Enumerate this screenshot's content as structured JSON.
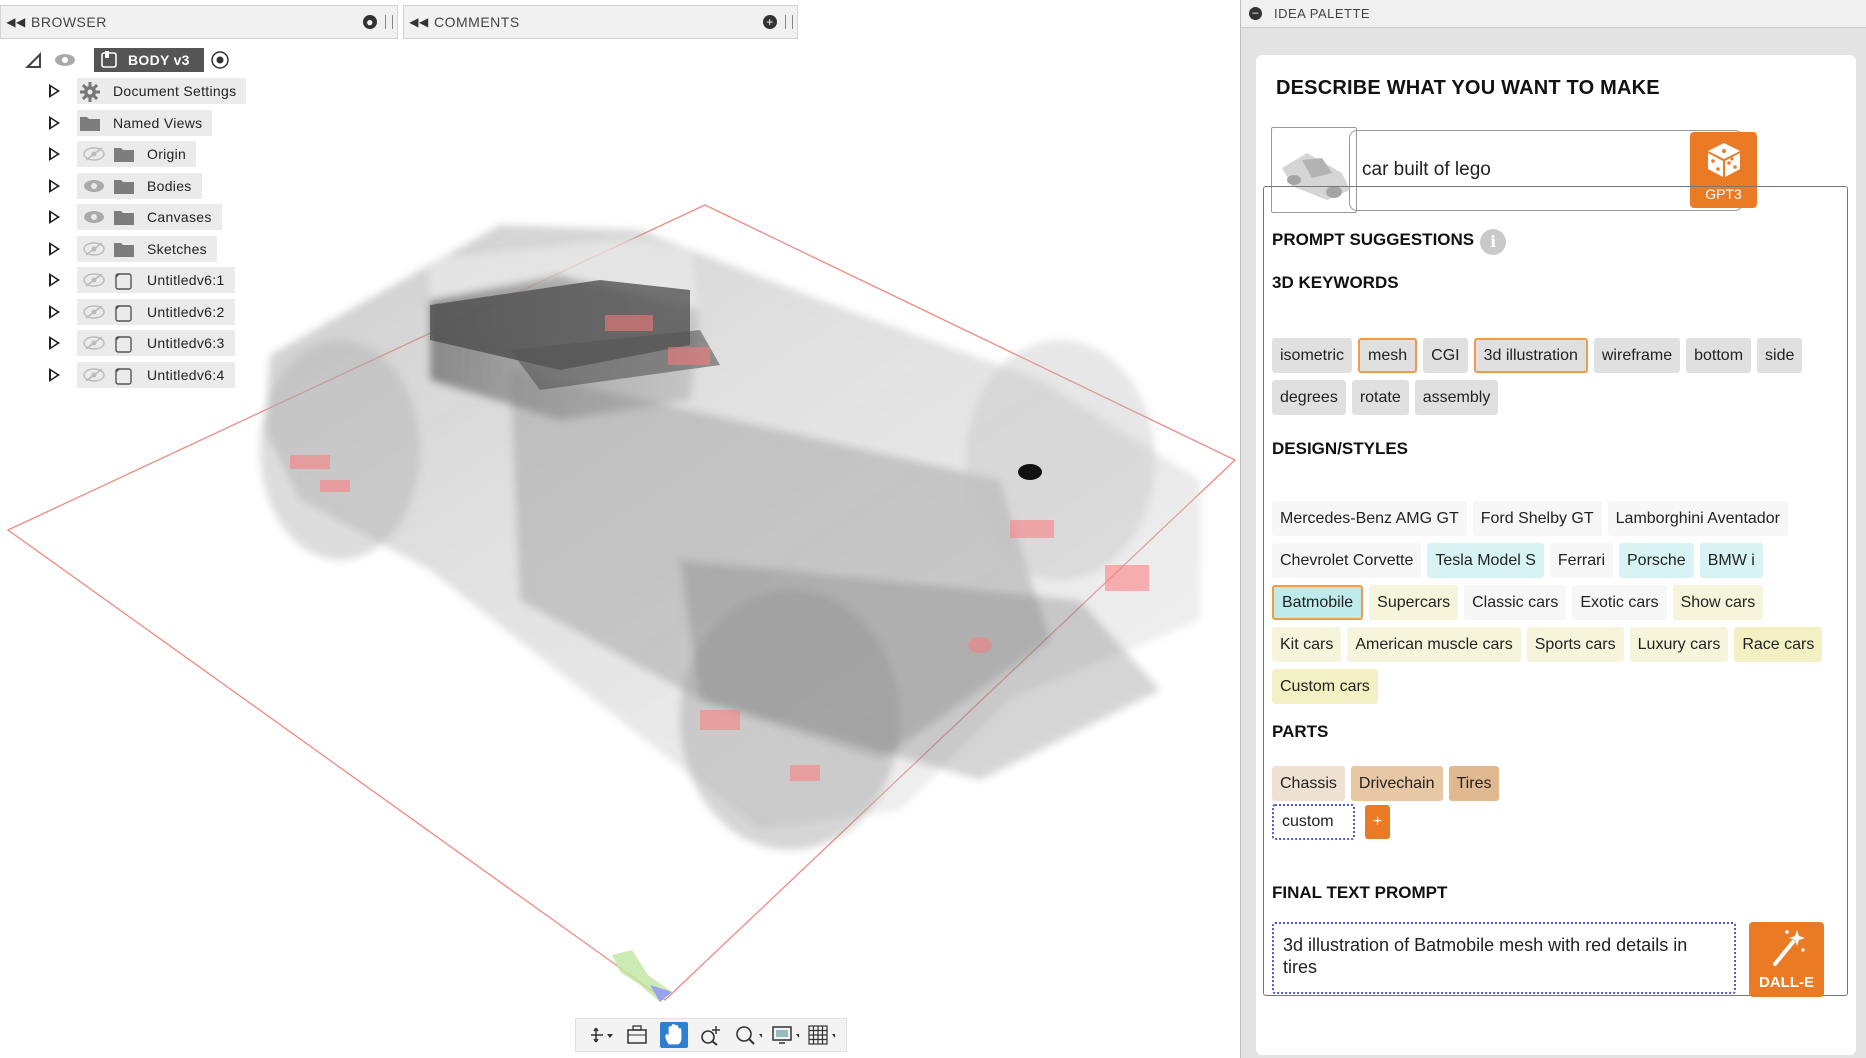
{
  "browser": {
    "title": "BROWSER",
    "root_label": "BODY v3",
    "items": [
      {
        "label": "Document Settings",
        "icon": "gear-icon",
        "eye": "none"
      },
      {
        "label": "Named Views",
        "icon": "folder-icon",
        "eye": "none"
      },
      {
        "label": "Origin",
        "icon": "folder-icon",
        "eye": "hidden"
      },
      {
        "label": "Bodies",
        "icon": "folder-icon",
        "eye": "visible"
      },
      {
        "label": "Canvases",
        "icon": "folder-icon",
        "eye": "visible"
      },
      {
        "label": "Sketches",
        "icon": "folder-icon",
        "eye": "hidden"
      },
      {
        "label": "Untitledv6:1",
        "icon": "component-icon",
        "eye": "hidden"
      },
      {
        "label": "Untitledv6:2",
        "icon": "component-icon",
        "eye": "hidden"
      },
      {
        "label": "Untitledv6:3",
        "icon": "component-icon",
        "eye": "hidden"
      },
      {
        "label": "Untitledv6:4",
        "icon": "component-icon",
        "eye": "hidden"
      }
    ]
  },
  "comments": {
    "title": "COMMENTS"
  },
  "toolbar": {
    "tools": [
      "orbit-icon",
      "look-at-icon",
      "pan-hand-icon",
      "zoom-icon",
      "zoom-window-icon",
      "display-settings-icon",
      "grid-icon"
    ],
    "active": "pan-hand-icon"
  },
  "palette": {
    "title": "IDEA PALETTE",
    "heading": "DESCRIBE WHAT YOU WANT TO MAKE",
    "prompt_value": "car built of lego",
    "gpt_button": "GPT3",
    "suggestions_heading": "PROMPT SUGGESTIONS",
    "keywords_heading": "3D KEYWORDS",
    "keywords": [
      {
        "label": "isometric",
        "selected": false
      },
      {
        "label": "mesh",
        "selected": true
      },
      {
        "label": "CGI",
        "selected": false
      },
      {
        "label": "3d illustration",
        "selected": true
      },
      {
        "label": "wireframe",
        "selected": false
      },
      {
        "label": "bottom",
        "selected": false
      },
      {
        "label": "side",
        "selected": false
      },
      {
        "label": "degrees",
        "selected": false
      },
      {
        "label": "rotate",
        "selected": false
      },
      {
        "label": "assembly",
        "selected": false
      }
    ],
    "styles_heading": "DESIGN/STYLES",
    "styles": [
      {
        "label": "Mercedes-Benz AMG GT",
        "tone": "plain"
      },
      {
        "label": "Ford Shelby GT",
        "tone": "plain"
      },
      {
        "label": "Lamborghini Aventador",
        "tone": "plain"
      },
      {
        "label": "Chevrolet Corvette",
        "tone": "plain"
      },
      {
        "label": "Tesla Model S",
        "tone": "cyan"
      },
      {
        "label": "Ferrari",
        "tone": "plain"
      },
      {
        "label": "Porsche",
        "tone": "cyan"
      },
      {
        "label": "BMW i",
        "tone": "cyan"
      },
      {
        "label": "Batmobile",
        "tone": "selected"
      },
      {
        "label": "Supercars",
        "tone": "yellow"
      },
      {
        "label": "Classic cars",
        "tone": "plain"
      },
      {
        "label": "Exotic cars",
        "tone": "plain"
      },
      {
        "label": "Show cars",
        "tone": "yellow"
      },
      {
        "label": "Kit cars",
        "tone": "yellow"
      },
      {
        "label": "American muscle cars",
        "tone": "yellow"
      },
      {
        "label": "Sports cars",
        "tone": "yellow"
      },
      {
        "label": "Luxury cars",
        "tone": "yellow"
      },
      {
        "label": "Race cars",
        "tone": "yellow2"
      },
      {
        "label": "Custom cars",
        "tone": "yellow2"
      }
    ],
    "parts_heading": "PARTS",
    "parts": [
      {
        "label": "Chassis",
        "tone": "light"
      },
      {
        "label": "Drivechain",
        "tone": "mid"
      },
      {
        "label": "Tires",
        "tone": "dark"
      }
    ],
    "custom_label": "custom",
    "plus_label": "+",
    "final_heading": "FINAL TEXT PROMPT",
    "final_prompt": "3d illustration of Batmobile mesh with red details in tires",
    "dalle_button": "DALL-E",
    "colors": {
      "accent": "#ea7a23",
      "selected_border": "#f29b47",
      "dotted_border": "#5257c9"
    }
  }
}
